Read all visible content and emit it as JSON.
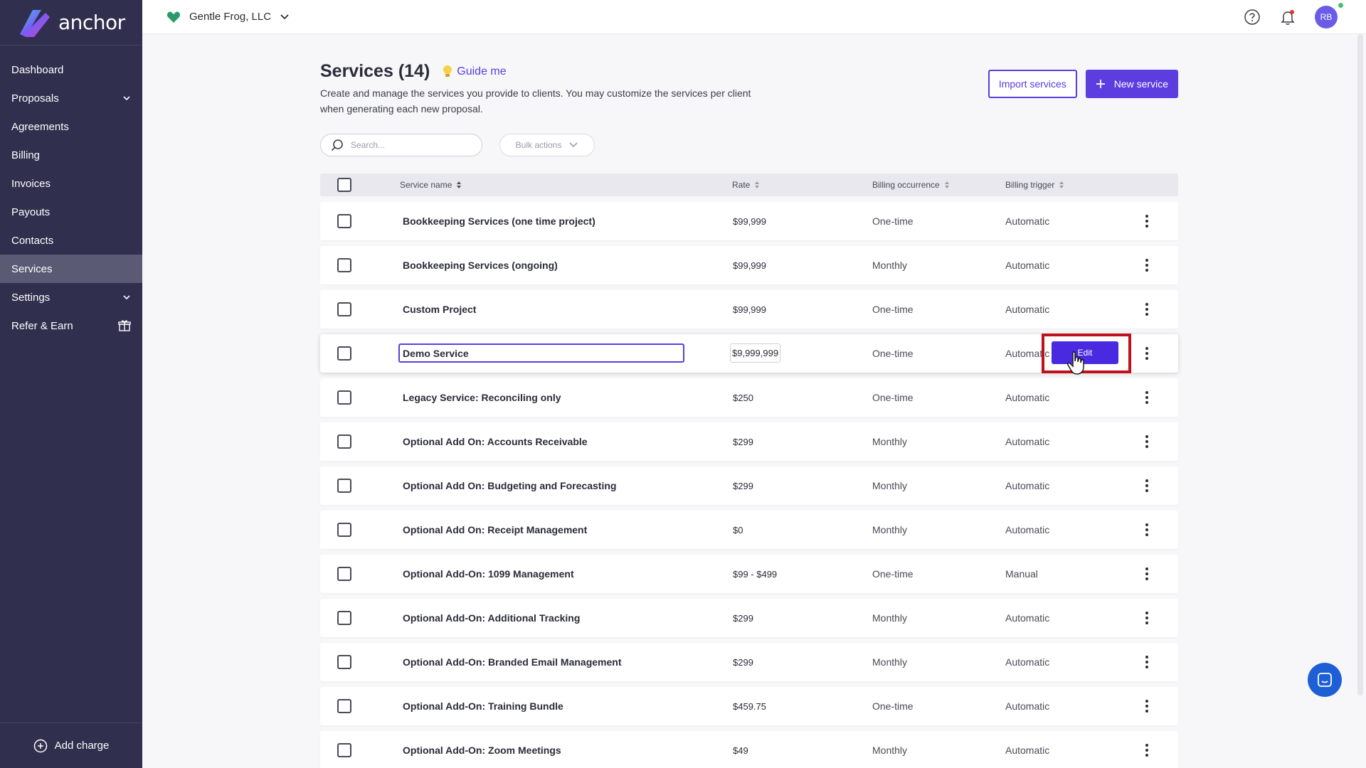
{
  "app": {
    "brand": "anchor",
    "accent": "#5b3de0",
    "sidebar_bg": "#302f4e"
  },
  "topbar": {
    "org_name": "Gentle Frog, LLC",
    "avatar_initials": "RB"
  },
  "sidebar": {
    "items": [
      {
        "label": "Dashboard"
      },
      {
        "label": "Proposals"
      },
      {
        "label": "Agreements"
      },
      {
        "label": "Billing"
      },
      {
        "label": "Invoices"
      },
      {
        "label": "Payouts"
      },
      {
        "label": "Contacts"
      },
      {
        "label": "Services"
      },
      {
        "label": "Settings"
      },
      {
        "label": "Refer & Earn"
      }
    ],
    "footer_label": "Add charge"
  },
  "page": {
    "title": "Services (14)",
    "guide_label": "Guide me",
    "subtitle": "Create and manage the services you provide to clients. You may customize the services per client when generating each new proposal.",
    "import_label": "Import services",
    "new_label": "New service",
    "search_placeholder": "Search...",
    "bulk_label": "Bulk actions"
  },
  "table": {
    "headers": {
      "name": "Service name",
      "rate": "Rate",
      "occurrence": "Billing occurrence",
      "trigger": "Billing trigger"
    },
    "rows": [
      {
        "name": "Bookkeeping Services (one time project)",
        "rate": "$99,999",
        "occurrence": "One-time",
        "trigger": "Automatic"
      },
      {
        "name": "Bookkeeping Services (ongoing)",
        "rate": "$99,999",
        "occurrence": "Monthly",
        "trigger": "Automatic"
      },
      {
        "name": "Custom Project",
        "rate": "$99,999",
        "occurrence": "One-time",
        "trigger": "Automatic"
      },
      {
        "name": "Demo Service",
        "rate": "$9,999,999",
        "occurrence": "One-time",
        "trigger": "Automatic"
      },
      {
        "name": "Legacy Service: Reconciling only",
        "rate": "$250",
        "occurrence": "One-time",
        "trigger": "Automatic"
      },
      {
        "name": "Optional Add On: Accounts Receivable",
        "rate": "$299",
        "occurrence": "Monthly",
        "trigger": "Automatic"
      },
      {
        "name": "Optional Add On: Budgeting and Forecasting",
        "rate": "$299",
        "occurrence": "Monthly",
        "trigger": "Automatic"
      },
      {
        "name": "Optional Add On: Receipt Management",
        "rate": "$0",
        "occurrence": "Monthly",
        "trigger": "Automatic"
      },
      {
        "name": "Optional Add-On: 1099 Management",
        "rate": "$99 - $499",
        "occurrence": "One-time",
        "trigger": "Manual"
      },
      {
        "name": "Optional Add-On: Additional Tracking",
        "rate": "$299",
        "occurrence": "Monthly",
        "trigger": "Automatic"
      },
      {
        "name": "Optional Add-On: Branded Email Management",
        "rate": "$299",
        "occurrence": "Monthly",
        "trigger": "Automatic"
      },
      {
        "name": "Optional Add-On: Training Bundle",
        "rate": "$459.75",
        "occurrence": "One-time",
        "trigger": "Automatic"
      },
      {
        "name": "Optional Add-On: Zoom Meetings",
        "rate": "$49",
        "occurrence": "Monthly",
        "trigger": "Automatic"
      }
    ],
    "edit_label": "Edit"
  }
}
